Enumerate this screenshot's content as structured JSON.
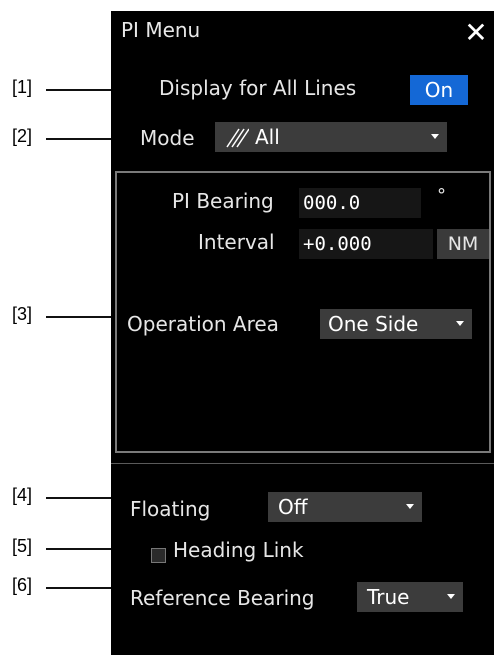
{
  "callouts": [
    "[1]",
    "[2]",
    "[3]",
    "[4]",
    "[5]",
    "[6]"
  ],
  "window": {
    "title": "PI Menu",
    "close_glyph": "✕"
  },
  "display_all_lines": {
    "label": "Display for All Lines",
    "button": "On"
  },
  "mode": {
    "label": "Mode",
    "value": "All",
    "icon": "hatch-lines-icon"
  },
  "pi": {
    "bearing_label": "PI Bearing",
    "bearing_value": "000.0",
    "bearing_unit": "°",
    "interval_label": "Interval",
    "interval_value": "+0.000",
    "interval_unit": "NM"
  },
  "operation_area": {
    "label": "Operation Area",
    "value": "One Side"
  },
  "floating": {
    "label": "Floating",
    "value": "Off"
  },
  "heading_link": {
    "label": "Heading Link",
    "checked": false
  },
  "reference_bearing": {
    "label": "Reference Bearing",
    "value": "True"
  },
  "colors": {
    "panel_bg": "#000000",
    "accent": "#1468d6",
    "dropdown_bg": "#3c3c3c"
  }
}
